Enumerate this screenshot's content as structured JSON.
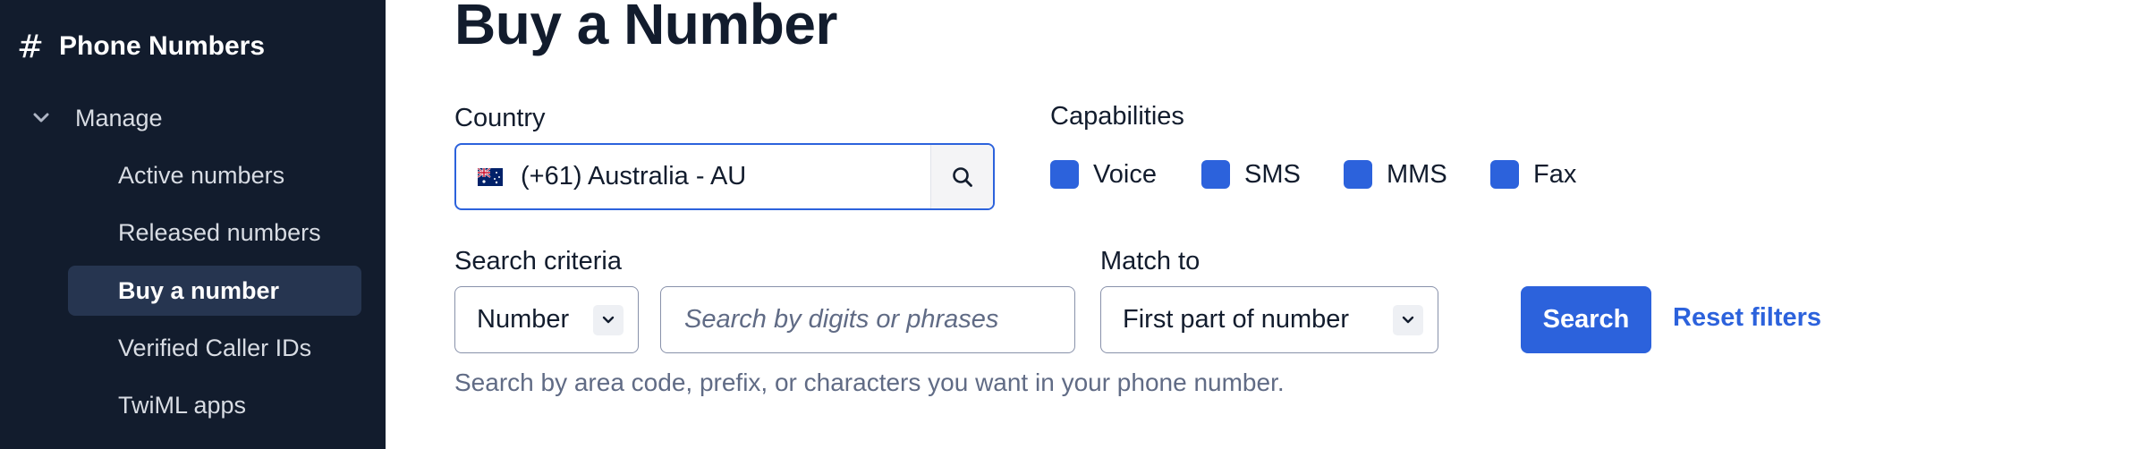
{
  "sidebar": {
    "header_icon": "#",
    "title": "Phone Numbers",
    "group": {
      "label": "Manage",
      "icon": "chevron-down-icon"
    },
    "items": [
      {
        "label": "Active numbers",
        "active": false
      },
      {
        "label": "Released numbers",
        "active": false
      },
      {
        "label": "Buy a number",
        "active": true
      },
      {
        "label": "Verified Caller IDs",
        "active": false
      },
      {
        "label": "TwiML apps",
        "active": false
      }
    ]
  },
  "main": {
    "title": "Buy a Number",
    "country": {
      "label": "Country",
      "value": "(+61) Australia - AU",
      "flag": "australia-flag-icon",
      "search_icon": "search-icon"
    },
    "capabilities": {
      "label": "Capabilities",
      "options": [
        {
          "label": "Voice",
          "checked": true
        },
        {
          "label": "SMS",
          "checked": true
        },
        {
          "label": "MMS",
          "checked": true
        },
        {
          "label": "Fax",
          "checked": true
        }
      ]
    },
    "search_criteria": {
      "label": "Search criteria",
      "selected": "Number",
      "input_placeholder": "Search by digits or phrases",
      "input_value": ""
    },
    "match_to": {
      "label": "Match to",
      "selected": "First part of number"
    },
    "search_button": "Search",
    "reset_link": "Reset filters",
    "help_text": "Search by area code, prefix, or characters you want in your phone number."
  },
  "colors": {
    "sidebar_bg": "#121c2d",
    "sidebar_active_bg": "#263550",
    "accent": "#2c62dc",
    "text": "#121c2d",
    "muted": "#606b85"
  }
}
